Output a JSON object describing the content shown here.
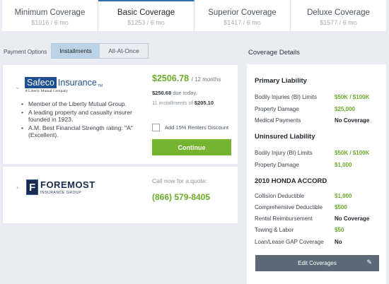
{
  "tabs": [
    {
      "name": "Minimum Coverage",
      "price": "$1016 / 6 mo"
    },
    {
      "name": "Basic Coverage",
      "price": "$1253 / 6 mo"
    },
    {
      "name": "Superior Coverage",
      "price": "$1417 / 6 mo"
    },
    {
      "name": "Deluxe Coverage",
      "price": "$1577 / 6 mo"
    }
  ],
  "payment": {
    "label": "Payment Options",
    "options": [
      "Installments",
      "All-At-Once"
    ],
    "selected": "Installments"
  },
  "quote1": {
    "logo_box": "Safeco",
    "logo_word": "Insurance",
    "logo_tm": "TM",
    "logo_sub": "A Liberty Mutual Company",
    "bullets": [
      "Member of the Liberty Mutual Group.",
      "A leading property and casualty insurer founded in 1923.",
      "A.M. Best Financial Strength rating: \"A\" (Excellent)."
    ],
    "price": "$2506.78",
    "price_period": "/ 12 months",
    "due_amount": "$250.68",
    "due_label": "due today.",
    "installments_label": "11 installments of",
    "installments_amount": "$205.10",
    "discount_label": "Add 15% Renters Discount",
    "continue_label": "Continue"
  },
  "quote2": {
    "logo_letter": "F",
    "logo_name": "FOREMOST",
    "logo_sub": "INSURANCE GROUP",
    "call_label": "Call now for a quote:",
    "phone": "(866) 579-8405"
  },
  "details": {
    "title": "Coverage Details",
    "primary_liability": "Primary Liability",
    "bi_limits_label": "Bodily Injuries (BI) Limits",
    "bi_limits_value": "$50K / $100K",
    "property_damage_label": "Property Damage",
    "property_damage_value": "$25,000",
    "medical_label": "Medical Payments",
    "medical_value": "No Coverage",
    "uninsured_liability": "Uninsured Liability",
    "ui_bi_label": "Bodily Injury (BI) Limits",
    "ui_bi_value": "$50K / $100K",
    "ui_pd_label": "Property Damage",
    "ui_pd_value": "$1,000",
    "vehicle": "2010 HONDA ACCORD",
    "collision_label": "Collision Deductible",
    "collision_value": "$1,000",
    "comprehensive_label": "Comprehensive Deductible",
    "comprehensive_value": "$500",
    "rental_label": "Rental Reimbursement",
    "rental_value": "No Coverage",
    "towing_label": "Towing & Labor",
    "towing_value": "$50",
    "gap_label": "Loan/Lease GAP Coverage",
    "gap_value": "No",
    "edit_label": "Edit Coverages"
  },
  "colors": {
    "accent_green": "#74b42f",
    "price_green": "#6aaa2a",
    "active_tab": "#2f6fb0",
    "edit_button": "#5c6a78",
    "toggle_active": "#bdd2e4"
  },
  "icons": [
    "chevron-down-icon",
    "chevron-right-icon",
    "pencil-icon",
    "checkbox-icon"
  ]
}
